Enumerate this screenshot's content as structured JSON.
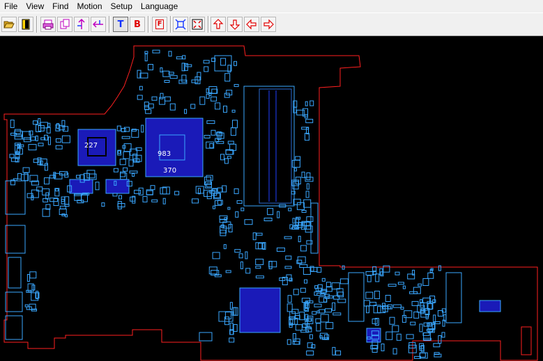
{
  "menu": {
    "file": "File",
    "view": "View",
    "find": "Find",
    "motion": "Motion",
    "setup": "Setup",
    "language": "Language"
  },
  "toolbar": {
    "top_side_label": "T",
    "bottom_side_label": "B",
    "frame_label": "F"
  },
  "board": {
    "part_labels": {
      "gpu": "227",
      "cpu": "983",
      "cpu_sub": "370"
    },
    "colors": {
      "background": "#000000",
      "outline": "#ff2020",
      "component": "#3aa7ff",
      "chip_fill": "#1a1ab8"
    }
  }
}
